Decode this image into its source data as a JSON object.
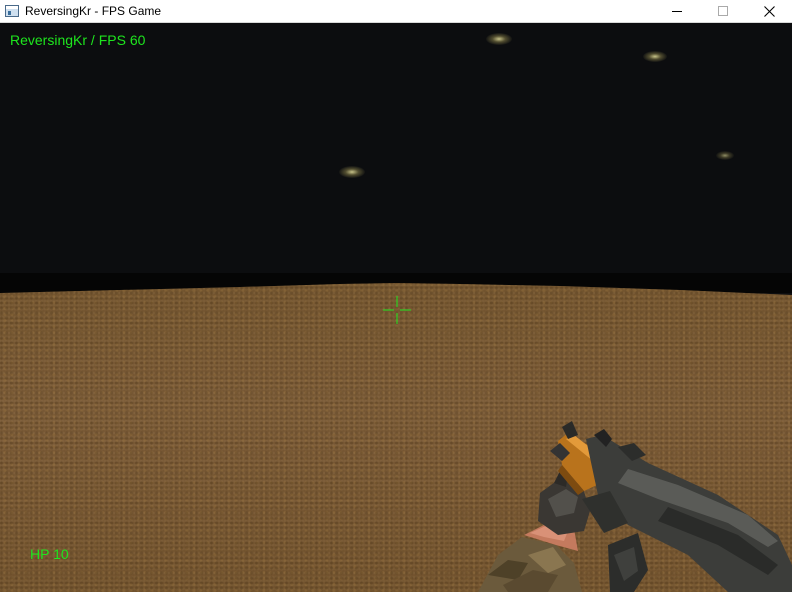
{
  "window": {
    "title": "ReversingKr - FPS Game",
    "icon": "app-window-icon",
    "controls": [
      "minimize-icon",
      "maximize-icon",
      "close-icon"
    ]
  },
  "hud": {
    "fps_label": "ReversingKr / FPS 60",
    "hp_label": "HP 10",
    "text_color": "#1ee61e",
    "crosshair_color": "#1ee61e"
  },
  "scene": {
    "sky_color": "#0c0d0f",
    "ground_color": "#7c5e37",
    "enemies_visible": 4,
    "weapon": "rifle"
  }
}
